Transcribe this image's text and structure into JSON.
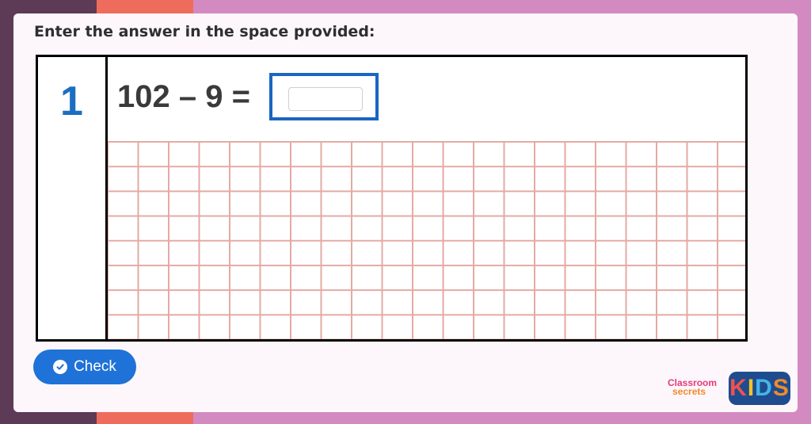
{
  "instruction": "Enter the answer in the space provided:",
  "question": {
    "number": "1",
    "equation": "102 – 9 =",
    "answer_value": ""
  },
  "check_button": {
    "label": "Check",
    "icon": "check-circle-icon"
  },
  "logo": {
    "line1": "Classroom",
    "line2": "secrets",
    "kids": [
      "K",
      "I",
      "D",
      "S"
    ],
    "kids_colors": [
      "#f0524f",
      "#f6c325",
      "#45b5e6",
      "#f08a2b"
    ]
  },
  "colors": {
    "accent_blue": "#1b6fc2",
    "button_blue": "#1f72d8",
    "grid_line": "#e4aaa3",
    "stripe_left": "#5d3a55",
    "stripe_orange": "#ee6c5c",
    "background_pink": "#d38ac0"
  }
}
